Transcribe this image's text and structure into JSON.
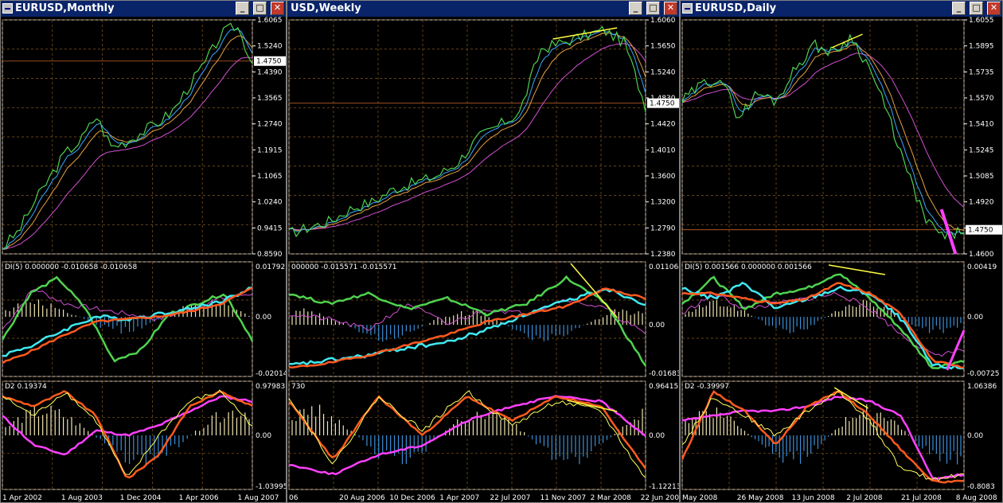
{
  "windows": [
    {
      "id": "monthly",
      "title": "EURUSD,Monthly",
      "price_ticks": [
        "1.6065",
        "1.5240",
        "1.4390",
        "1.3565",
        "1.2740",
        "1.1915",
        "1.1065",
        "1.0240",
        "0.9415",
        "0.8590"
      ],
      "price_label": "1.4750",
      "osc1_label": "DI(5) 0.000000 -0.010658 -0.010658",
      "osc1_ticks": [
        "0.017923",
        "0.00",
        "-0.02014"
      ],
      "osc2_label": "D2 0.19374",
      "osc2_ticks": [
        "0.97983",
        "0.00",
        "-1.03995"
      ],
      "date_ticks": [
        "1 Apr 2002",
        "1 Aug 2003",
        "1 Dec 2004",
        "1 Apr 2006",
        "1 Aug 2007"
      ]
    },
    {
      "id": "weekly",
      "title": "USD,Weekly",
      "price_ticks": [
        "1.6060",
        "1.5650",
        "1.5240",
        "1.4830",
        "1.4420",
        "1.4010",
        "1.3600",
        "1.3200",
        "1.2790",
        "1.2380"
      ],
      "price_label": "1.4750",
      "osc1_label": "000000 -0.015571 -0.015571",
      "osc1_ticks": [
        "0.011064",
        "0.00",
        "-0.01683"
      ],
      "osc2_label": "730",
      "osc2_ticks": [
        "0.96415",
        "0.00",
        "-1.12213"
      ],
      "date_ticks": [
        "06",
        "20 Aug 2006",
        "10 Dec 2006",
        "1 Apr 2007",
        "22 Jul 2007",
        "11 Nov 2007",
        "2 Mar 2008",
        "22 Jun 2008"
      ]
    },
    {
      "id": "daily",
      "title": "EURUSD,Daily",
      "price_ticks": [
        "1.6055",
        "1.5895",
        "1.5735",
        "1.5570",
        "1.5410",
        "1.5245",
        "1.5085",
        "1.4920",
        "1.4750",
        "1.4600"
      ],
      "price_label": "1.4750",
      "osc1_label": "DI(5) 0.001566 0.000000 0.001566",
      "osc1_ticks": [
        "0.00419",
        "0.00",
        "-0.00725"
      ],
      "osc2_label": "D2 -0.39997",
      "osc2_ticks": [
        "1.06386",
        "0.00",
        "-0.8083"
      ],
      "date_ticks": [
        "May 2008",
        "26 May 2008",
        "13 Jun 2008",
        "2 Jul 2008",
        "21 Jul 2008",
        "8 Aug 2008"
      ]
    }
  ],
  "chart_data": [
    {
      "type": "line",
      "title": "EURUSD,Monthly",
      "x": [
        "1 Apr 2002",
        "1 Aug 2003",
        "1 Dec 2004",
        "1 Apr 2006",
        "1 Aug 2007"
      ],
      "ylim": [
        0.859,
        1.6065
      ],
      "series": [
        {
          "values": [
            0.88,
            0.93,
            1.02,
            1.1,
            1.18,
            1.22,
            1.3,
            1.2,
            1.22,
            1.25,
            1.28,
            1.32,
            1.4,
            1.47,
            1.56,
            1.59,
            1.47
          ]
        }
      ],
      "current_price": 1.475
    },
    {
      "type": "line",
      "title": "USD,Weekly",
      "x": [
        "20 Aug 2006",
        "10 Dec 2006",
        "1 Apr 2007",
        "22 Jul 2007",
        "11 Nov 2007",
        "2 Mar 2008",
        "22 Jun 2008"
      ],
      "ylim": [
        1.238,
        1.606
      ],
      "series": [
        {
          "values": [
            1.27,
            1.28,
            1.29,
            1.31,
            1.32,
            1.34,
            1.35,
            1.36,
            1.38,
            1.42,
            1.44,
            1.46,
            1.56,
            1.57,
            1.58,
            1.59,
            1.57,
            1.47
          ]
        }
      ],
      "current_price": 1.475
    },
    {
      "type": "line",
      "title": "EURUSD,Daily",
      "x": [
        "May 2008",
        "26 May 2008",
        "13 Jun 2008",
        "2 Jul 2008",
        "21 Jul 2008",
        "8 Aug 2008"
      ],
      "ylim": [
        1.46,
        1.6055
      ],
      "series": [
        {
          "values": [
            1.555,
            1.565,
            1.57,
            1.545,
            1.56,
            1.555,
            1.575,
            1.59,
            1.585,
            1.595,
            1.575,
            1.545,
            1.51,
            1.48,
            1.47,
            1.475
          ]
        }
      ],
      "current_price": 1.475
    }
  ]
}
